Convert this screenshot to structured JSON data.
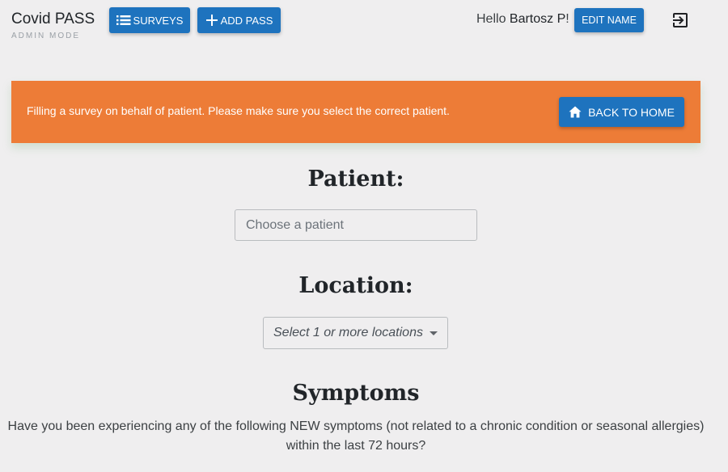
{
  "header": {
    "brand_title": "Covid PASS",
    "brand_subtitle": "ADMIN MODE",
    "surveys_label": "SURVEYS",
    "add_pass_label": "ADD PASS",
    "greeting": "Hello ",
    "user_name": "Bartosz P",
    "greeting_suffix": "!",
    "edit_name_label": "EDIT NAME",
    "logout_icon": "logout-icon"
  },
  "banner": {
    "message": "Filling a survey on behalf of patient. Please make sure you select the correct patient.",
    "back_label": "BACK TO HOME",
    "color": "#ed7c37"
  },
  "patient": {
    "heading": "Patient:",
    "placeholder": "Choose a patient"
  },
  "location": {
    "heading": "Location:",
    "placeholder": "Select 1 or more locations"
  },
  "symptoms": {
    "heading": "Symptoms",
    "question": "Have you been experiencing any of the following NEW symptoms (not related to a chronic condition or seasonal allergies) within the last 72 hours?"
  },
  "colors": {
    "primary": "#1e73be",
    "background": "#efeeef"
  }
}
